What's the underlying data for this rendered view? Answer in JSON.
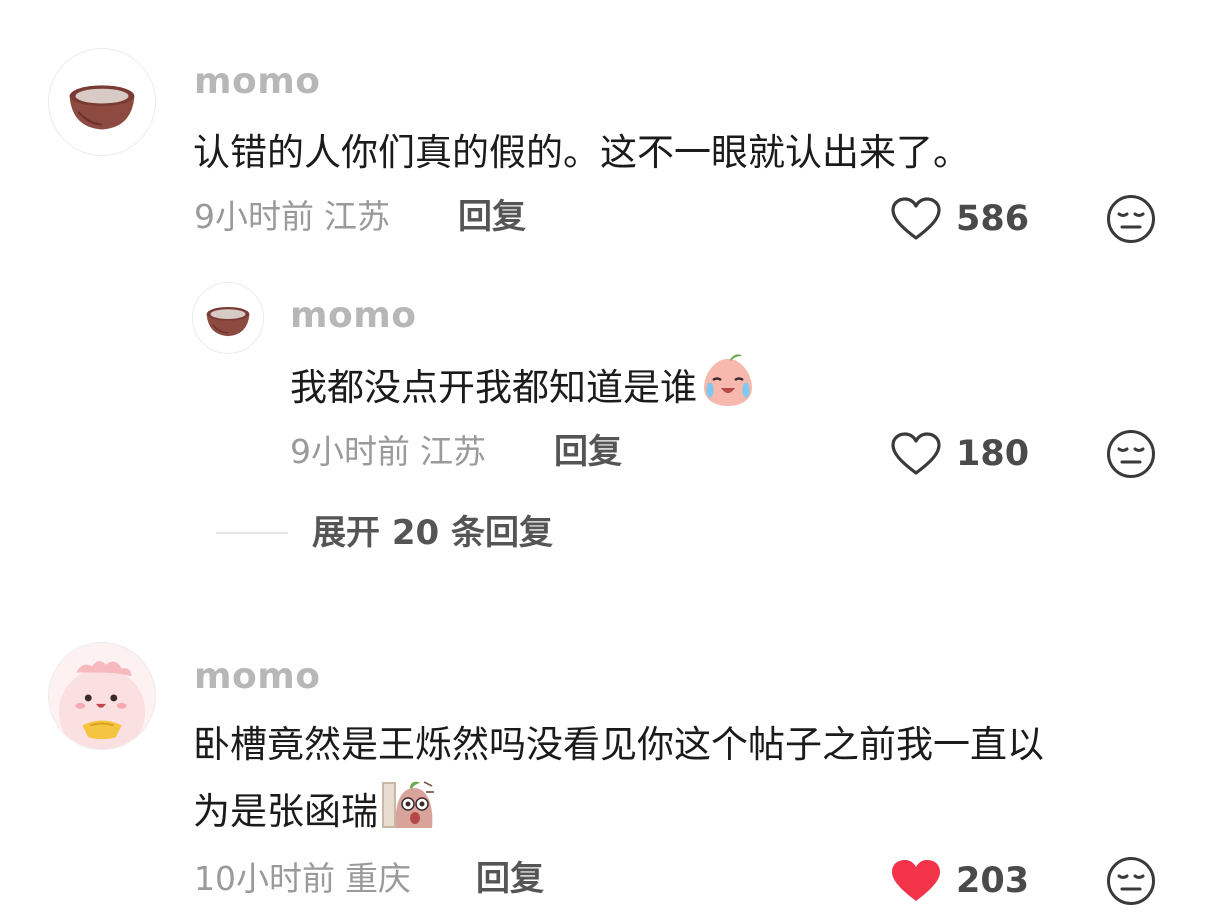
{
  "comments": [
    {
      "username": "momo",
      "text": "认错的人你们真的假的。这不一眼就认出来了。",
      "time": "9小时前",
      "location": "江苏",
      "reply_label": "回复",
      "likes": "586",
      "liked": false,
      "avatar_icon": "coconut-bowl-icon"
    },
    {
      "username": "momo",
      "text": "我都没点开我都知道是谁",
      "emoji": "crying-peach-emoji",
      "time": "9小时前",
      "location": "江苏",
      "reply_label": "回复",
      "likes": "180",
      "liked": false,
      "avatar_icon": "coconut-bowl-icon"
    },
    {
      "username": "momo",
      "text_line1": "卧槽竟然是王烁然吗没看见你这个帖子之前我一直以",
      "text_line2": "为是张函瑞",
      "emoji": "peeking-potato-emoji",
      "time": "10小时前",
      "location": "重庆",
      "reply_label": "回复",
      "likes": "203",
      "liked": true,
      "avatar_icon": "pink-cartoon-avatar-icon"
    }
  ],
  "expand_replies_label": "展开 20 条回复",
  "colors": {
    "liked_heart": "#f2334a",
    "muted_text": "#9a9a9a",
    "username": "#b7b7b7"
  }
}
